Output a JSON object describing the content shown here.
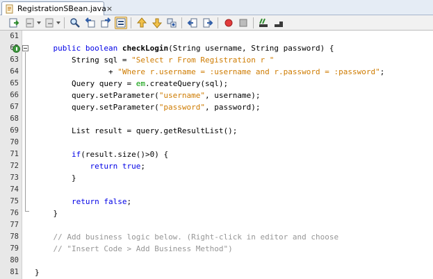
{
  "tab": {
    "file_name": "RegistrationSBean.java",
    "close": "×"
  },
  "toolbar": {
    "icons": [
      "last-edit-icon",
      "back-icon",
      "forward-icon",
      "find-icon",
      "find-previous-icon",
      "find-next-icon",
      "toggle-highlight-icon",
      "previous-bookmark-icon",
      "next-bookmark-icon",
      "toggle-bookmark-icon",
      "shift-left-icon",
      "shift-right-icon",
      "start-macro-icon",
      "stop-macro-icon",
      "comment-icon",
      "uncomment-icon"
    ]
  },
  "colors": {
    "keyword": "#0000e6",
    "string": "#ce7b00",
    "field": "#009900",
    "comment": "#969696",
    "gutter": "#e8e8e8"
  },
  "editor": {
    "lines": [
      {
        "n": "61",
        "parts": []
      },
      {
        "n": "62",
        "parts": [
          {
            "t": "    ",
            "c": ""
          },
          {
            "t": "public",
            "c": "kw"
          },
          {
            "t": " ",
            "c": ""
          },
          {
            "t": "boolean",
            "c": "kw"
          },
          {
            "t": " ",
            "c": ""
          },
          {
            "t": "checkLogin",
            "c": "mth"
          },
          {
            "t": "(String username, String password) {",
            "c": ""
          }
        ]
      },
      {
        "n": "63",
        "parts": [
          {
            "t": "        String sql = ",
            "c": ""
          },
          {
            "t": "\"Select r From Registration r \"",
            "c": "str"
          }
        ]
      },
      {
        "n": "64",
        "parts": [
          {
            "t": "                + ",
            "c": ""
          },
          {
            "t": "\"Where r.username = :username and r.password = :password\"",
            "c": "str"
          },
          {
            "t": ";",
            "c": ""
          }
        ]
      },
      {
        "n": "65",
        "parts": [
          {
            "t": "        Query query = ",
            "c": ""
          },
          {
            "t": "em",
            "c": "fld"
          },
          {
            "t": ".createQuery(sql);",
            "c": ""
          }
        ]
      },
      {
        "n": "66",
        "parts": [
          {
            "t": "        query.setParameter(",
            "c": ""
          },
          {
            "t": "\"username\"",
            "c": "str"
          },
          {
            "t": ", username);",
            "c": ""
          }
        ]
      },
      {
        "n": "67",
        "parts": [
          {
            "t": "        query.setParameter(",
            "c": ""
          },
          {
            "t": "\"password\"",
            "c": "str"
          },
          {
            "t": ", password);",
            "c": ""
          }
        ]
      },
      {
        "n": "68",
        "parts": []
      },
      {
        "n": "69",
        "parts": [
          {
            "t": "        List result = query.getResultList();",
            "c": ""
          }
        ]
      },
      {
        "n": "70",
        "parts": []
      },
      {
        "n": "71",
        "parts": [
          {
            "t": "        ",
            "c": ""
          },
          {
            "t": "if",
            "c": "kw"
          },
          {
            "t": "(result.size()>0) {",
            "c": ""
          }
        ]
      },
      {
        "n": "72",
        "parts": [
          {
            "t": "            ",
            "c": ""
          },
          {
            "t": "return",
            "c": "kw"
          },
          {
            "t": " ",
            "c": ""
          },
          {
            "t": "true",
            "c": "kw"
          },
          {
            "t": ";",
            "c": ""
          }
        ]
      },
      {
        "n": "73",
        "parts": [
          {
            "t": "        }",
            "c": ""
          }
        ]
      },
      {
        "n": "74",
        "parts": []
      },
      {
        "n": "75",
        "parts": [
          {
            "t": "        ",
            "c": ""
          },
          {
            "t": "return",
            "c": "kw"
          },
          {
            "t": " ",
            "c": ""
          },
          {
            "t": "false",
            "c": "kw"
          },
          {
            "t": ";",
            "c": ""
          }
        ]
      },
      {
        "n": "76",
        "parts": [
          {
            "t": "    }",
            "c": ""
          }
        ]
      },
      {
        "n": "77",
        "parts": []
      },
      {
        "n": "78",
        "parts": [
          {
            "t": "    ",
            "c": ""
          },
          {
            "t": "// Add business logic below. (Right-click in editor and choose",
            "c": "cmt"
          }
        ]
      },
      {
        "n": "79",
        "parts": [
          {
            "t": "    ",
            "c": ""
          },
          {
            "t": "// \"Insert Code > Add Business Method\")",
            "c": "cmt"
          }
        ]
      },
      {
        "n": "80",
        "parts": []
      },
      {
        "n": "81",
        "parts": [
          {
            "t": "}",
            "c": ""
          }
        ]
      }
    ]
  }
}
